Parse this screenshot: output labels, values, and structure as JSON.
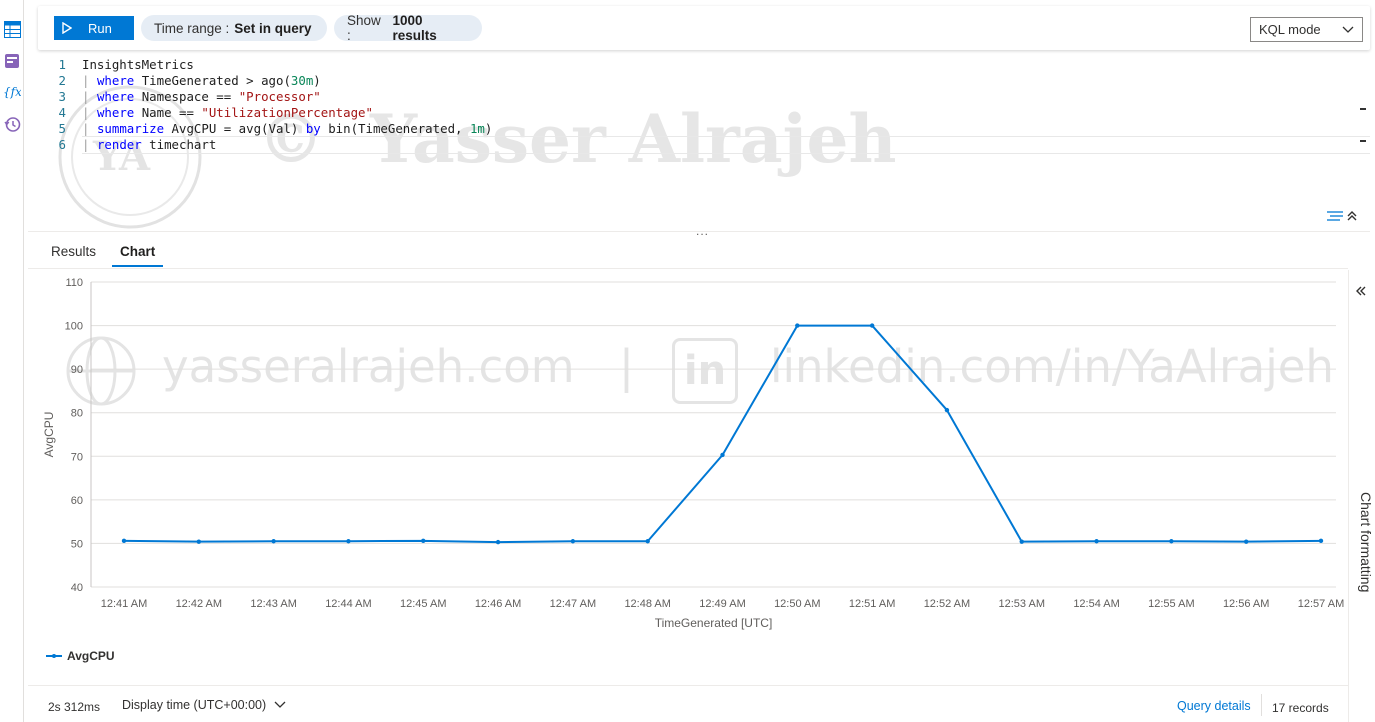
{
  "toolbar": {
    "run_label": "Run",
    "time_range_label": "Time range :",
    "time_range_value": "Set in query",
    "show_label": "Show :",
    "show_value": "1000 results",
    "mode_label": "KQL mode"
  },
  "editor": {
    "lines": [
      {
        "num": "1",
        "text": "InsightsMetrics"
      },
      {
        "num": "2",
        "pipe": "|",
        "kw": "where",
        "text": " TimeGenerated > ago(",
        "num_lit": "30m",
        "tail": ")"
      },
      {
        "num": "3",
        "pipe": "|",
        "kw": "where",
        "text": " Namespace == ",
        "str": "\"Processor\""
      },
      {
        "num": "4",
        "pipe": "|",
        "kw": "where",
        "text": " Name == ",
        "str": "\"UtilizationPercentage\""
      },
      {
        "num": "5",
        "pipe": "|",
        "kw": "summarize",
        "text": " AvgCPU = avg(Val) ",
        "kw2": "by",
        "text2": " bin(TimeGenerated, ",
        "num_lit": "1m",
        "tail": ")"
      },
      {
        "num": "6",
        "pipe": "|",
        "kw": "render",
        "text": " timechart"
      }
    ]
  },
  "splitter_dots": "...",
  "tabs": {
    "results": "Results",
    "chart": "Chart"
  },
  "chart_data": {
    "type": "line",
    "title": "",
    "xlabel": "TimeGenerated [UTC]",
    "ylabel": "AvgCPU",
    "ylim": [
      40,
      110
    ],
    "yticks": [
      "40",
      "50",
      "60",
      "70",
      "80",
      "90",
      "100",
      "110"
    ],
    "categories": [
      "12:41 AM",
      "12:42 AM",
      "12:43 AM",
      "12:44 AM",
      "12:45 AM",
      "12:46 AM",
      "12:47 AM",
      "12:48 AM",
      "12:49 AM",
      "12:50 AM",
      "12:51 AM",
      "12:52 AM",
      "12:53 AM",
      "12:54 AM",
      "12:55 AM",
      "12:56 AM",
      "12:57 AM"
    ],
    "series": [
      {
        "name": "AvgCPU",
        "values": [
          50.6,
          50.4,
          50.5,
          50.5,
          50.6,
          50.3,
          50.5,
          50.5,
          70.3,
          100,
          100,
          80.6,
          50.4,
          50.5,
          50.5,
          50.4,
          50.6
        ],
        "color": "#0078d4"
      }
    ],
    "grid": true,
    "legend": "bottom-left"
  },
  "legend": {
    "label": "AvgCPU"
  },
  "side_panel": {
    "label": "Chart formatting"
  },
  "footer": {
    "duration": "2s 312ms",
    "display_time": "Display time (UTC+00:00)",
    "query_details": "Query details",
    "records": "17 records"
  },
  "watermark": {
    "name": "Yasser Alrajeh",
    "url": "yasseralrajeh.com",
    "sep": "|",
    "in": "in",
    "linkedin": "linkedin.com/in/YaAlrajeh",
    "initials": "YA",
    "copyright": "©"
  },
  "icons": {
    "rail": [
      "table-icon",
      "query-pack-icon",
      "function-icon",
      "history-icon"
    ]
  },
  "colors": {
    "accent": "#0078d4",
    "pill_bg": "#e6edf5",
    "grid": "#e1dfdd"
  }
}
